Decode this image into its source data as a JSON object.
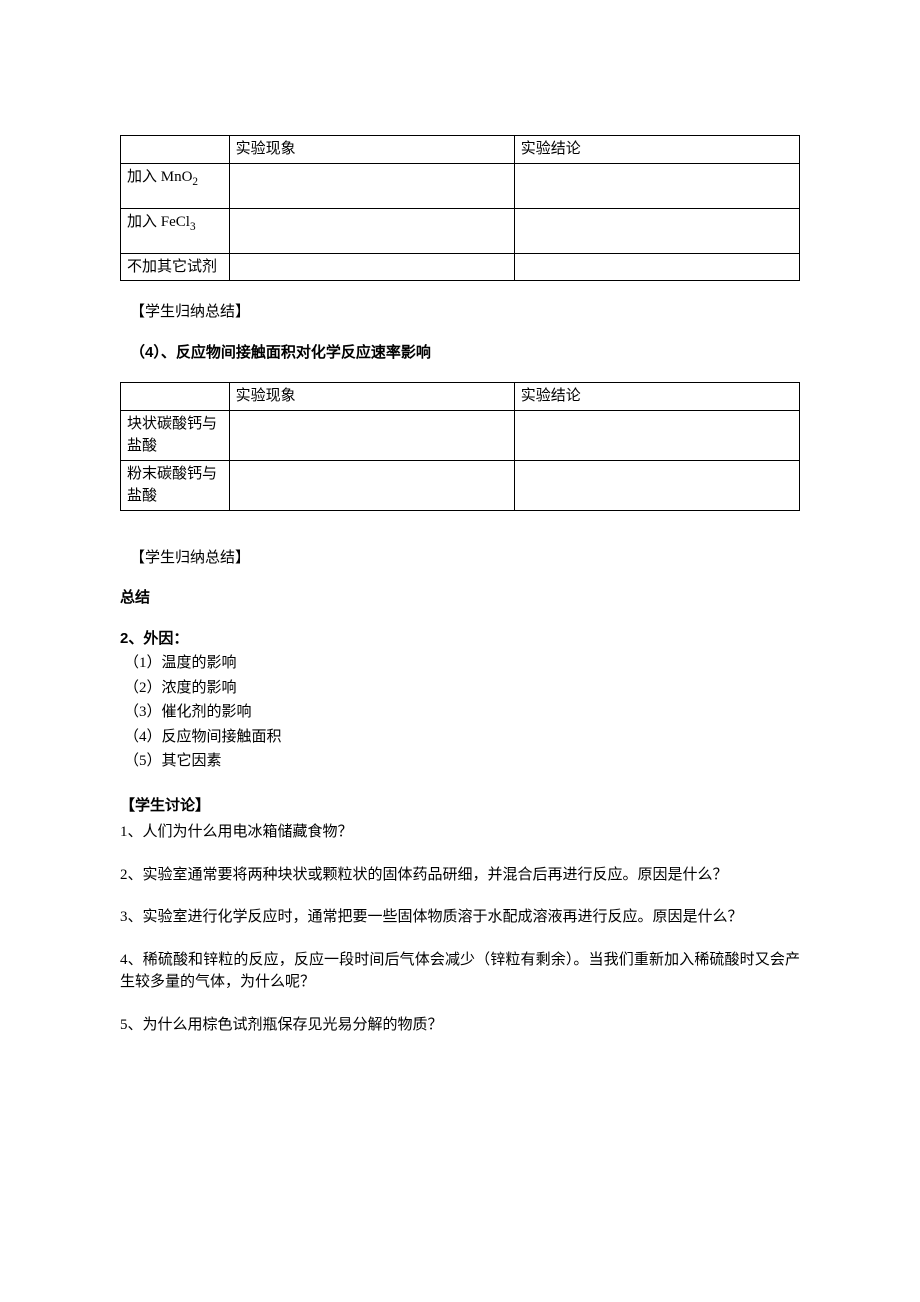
{
  "table1": {
    "headers": [
      "",
      "实验现象",
      "实验结论"
    ],
    "rows": [
      {
        "label_pre": "加入 MnO",
        "label_sub": "2"
      },
      {
        "label_pre": "加入 FeCl",
        "label_sub": "3"
      },
      {
        "label_pre": "不加其它试剂",
        "label_sub": ""
      }
    ]
  },
  "summary_label": "【学生归纳总结】",
  "heading4": "（4）、反应物间接触面积对化学反应速率影响",
  "table2": {
    "headers": [
      "",
      "实验现象",
      "实验结论"
    ],
    "rows": [
      {
        "label": "块状碳酸钙与盐酸"
      },
      {
        "label": "粉末碳酸钙与盐酸"
      }
    ]
  },
  "summary_label2": "【学生归纳总结】",
  "zongjie": "总结",
  "waiyin_head": "2、外因：",
  "waiyin_items": [
    "（1）温度的影响",
    "（2）浓度的影响",
    "（3）催化剂的影响",
    "（4）反应物间接触面积",
    "（5）其它因素"
  ],
  "discuss_head": "【学生讨论】",
  "questions": [
    "1、人们为什么用电冰箱储藏食物？",
    "2、实验室通常要将两种块状或颗粒状的固体药品研细，并混合后再进行反应。原因是什么？",
    "3、实验室进行化学反应时，通常把要一些固体物质溶于水配成溶液再进行反应。原因是什么？",
    "4、稀硫酸和锌粒的反应，反应一段时间后气体会减少（锌粒有剩余）。当我们重新加入稀硫酸时又会产生较多量的气体，为什么呢？",
    "5、为什么用棕色试剂瓶保存见光易分解的物质？"
  ]
}
